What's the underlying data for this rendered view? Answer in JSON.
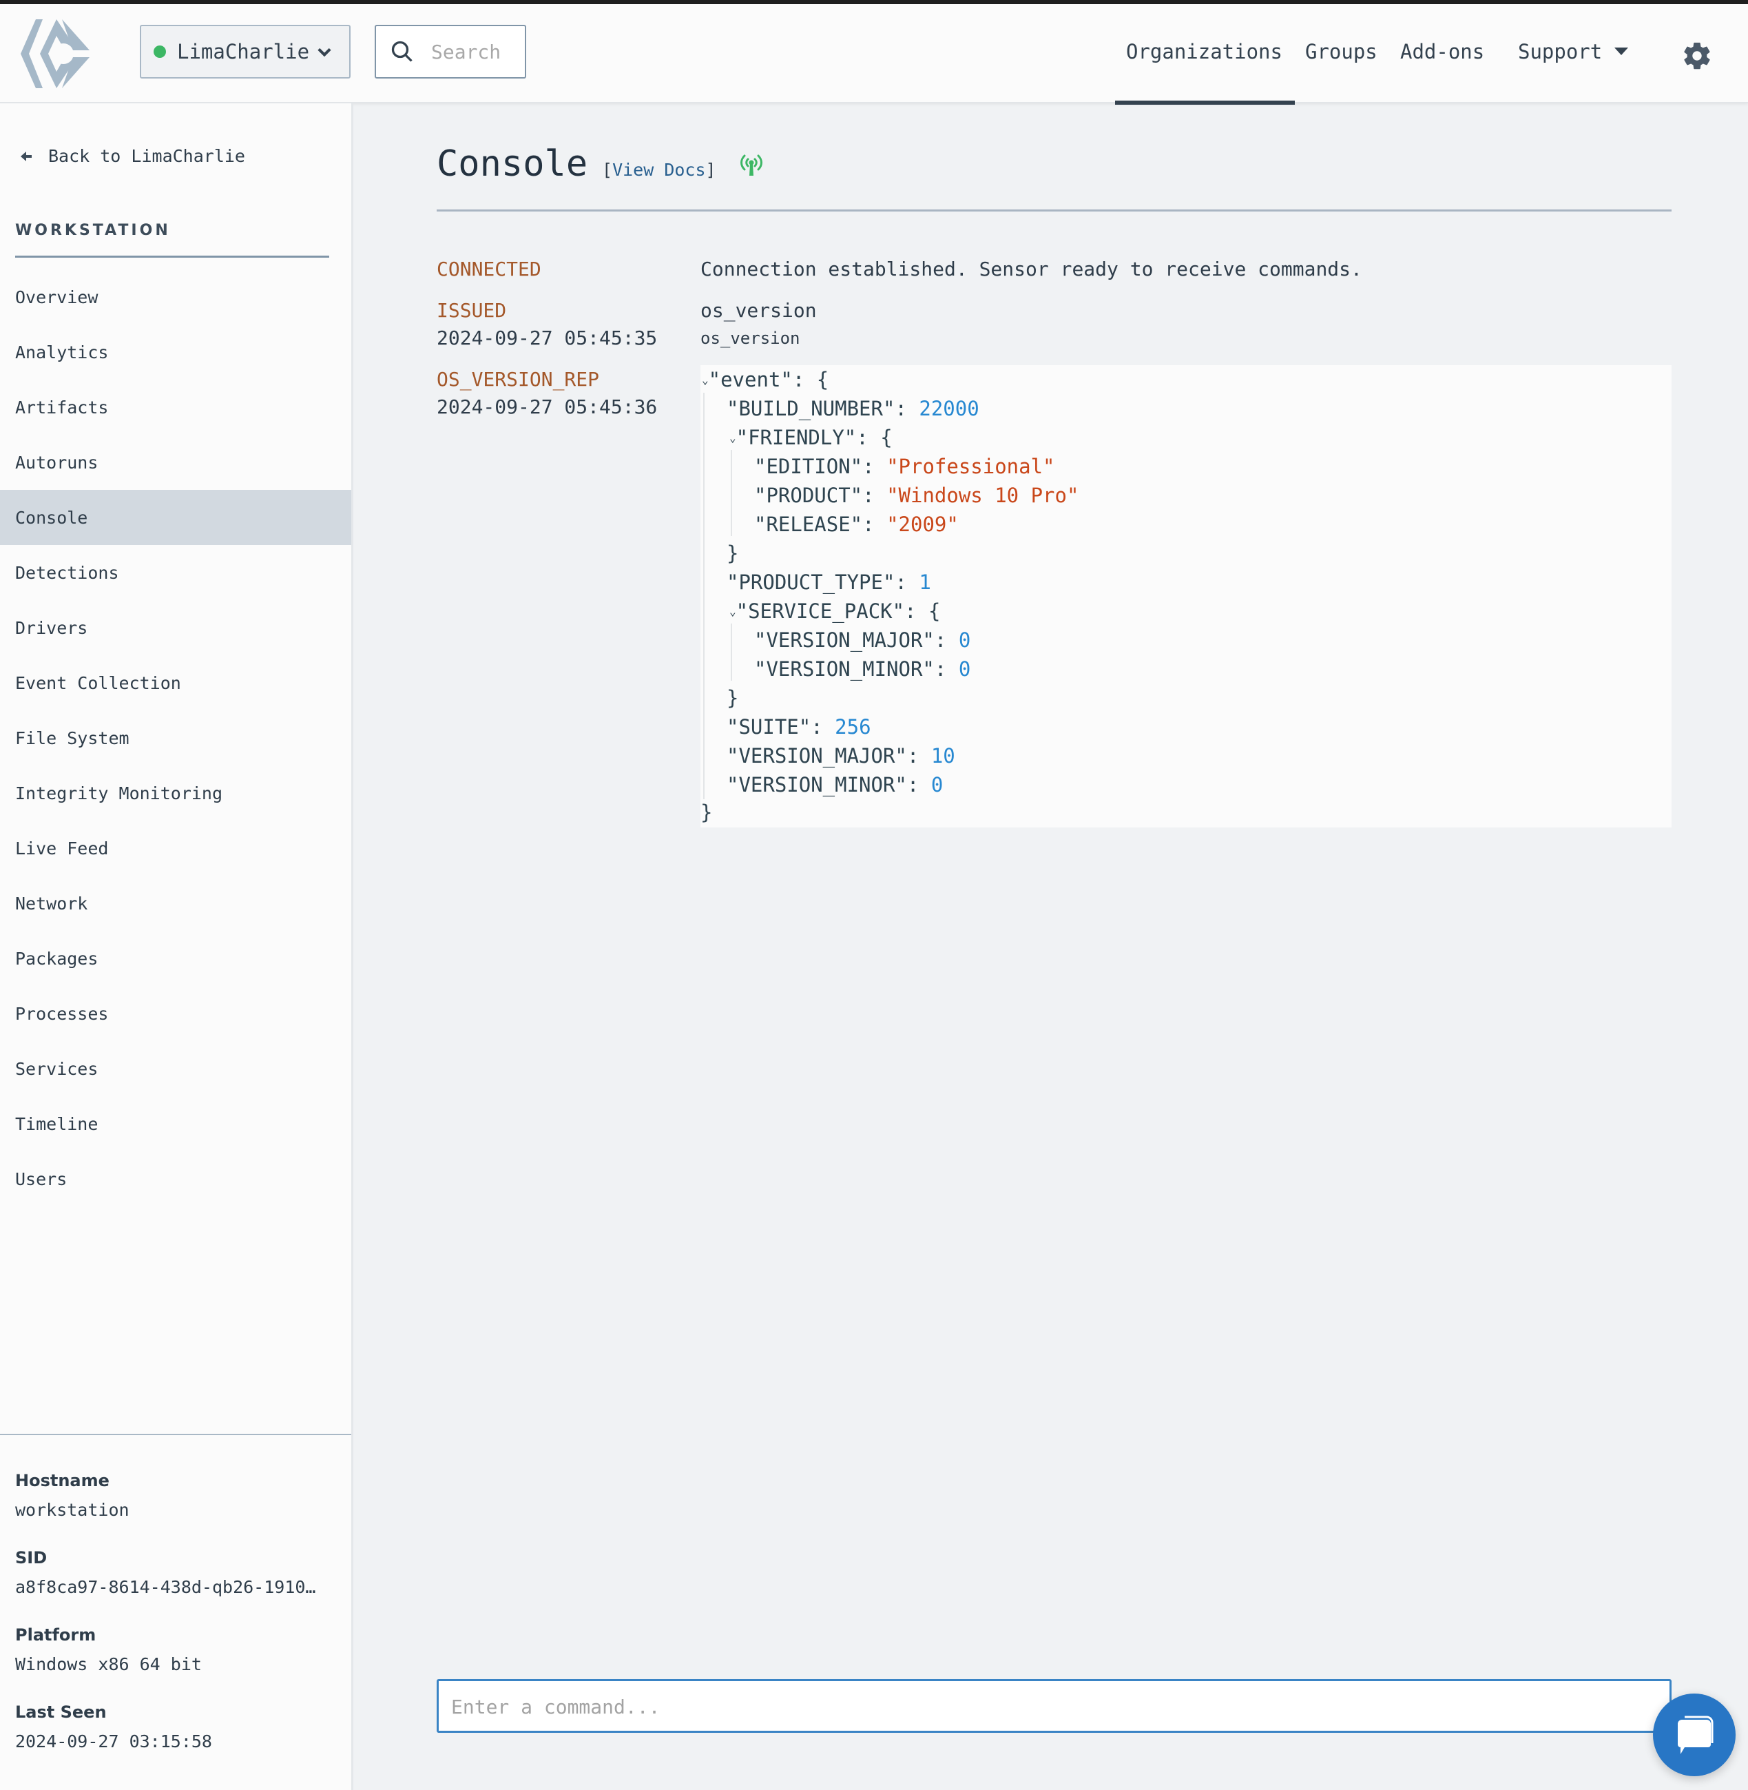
{
  "header": {
    "org_name": "LimaCharlie",
    "org_status_color": "#3cb764",
    "search_placeholder": "Search",
    "nav": [
      "Organizations",
      "Groups",
      "Add-ons",
      "Support"
    ],
    "active_nav": "Organizations"
  },
  "sidebar": {
    "back_label": "Back to LimaCharlie",
    "section_title": "WORKSTATION",
    "items": [
      {
        "label": "Overview"
      },
      {
        "label": "Analytics"
      },
      {
        "label": "Artifacts"
      },
      {
        "label": "Autoruns"
      },
      {
        "label": "Console",
        "active": true
      },
      {
        "label": "Detections"
      },
      {
        "label": "Drivers"
      },
      {
        "label": "Event Collection"
      },
      {
        "label": "File System"
      },
      {
        "label": "Integrity Monitoring"
      },
      {
        "label": "Live Feed"
      },
      {
        "label": "Network"
      },
      {
        "label": "Packages"
      },
      {
        "label": "Processes"
      },
      {
        "label": "Services"
      },
      {
        "label": "Timeline"
      },
      {
        "label": "Users"
      }
    ],
    "info": {
      "hostname_label": "Hostname",
      "hostname": "workstation",
      "sid_label": "SID",
      "sid": "a8f8ca97-8614-438d-qb26-1910…",
      "platform_label": "Platform",
      "platform": "Windows x86 64 bit",
      "last_seen_label": "Last Seen",
      "last_seen": "2024-09-27 03:15:58"
    }
  },
  "main": {
    "title": "Console",
    "docs_open": "[",
    "docs_label": "View Docs",
    "docs_close": "]",
    "connection_icon_color": "#3cb764",
    "log": {
      "connected": {
        "label": "CONNECTED",
        "message": "Connection established. Sensor ready to receive commands."
      },
      "issued": {
        "label": "ISSUED",
        "timestamp": "2024-09-27 05:45:35",
        "command": "os_version",
        "sub": "os_version"
      },
      "response": {
        "label": "OS_VERSION_REP",
        "timestamp": "2024-09-27 05:45:36"
      }
    },
    "json_lines": {
      "event_key": "\"event\"",
      "build_key": "\"BUILD_NUMBER\"",
      "build_val": "22000",
      "friendly_key": "\"FRIENDLY\"",
      "edition_key": "\"EDITION\"",
      "edition_val": "\"Professional\"",
      "product_key": "\"PRODUCT\"",
      "product_val": "\"Windows 10 Pro\"",
      "release_key": "\"RELEASE\"",
      "release_val": "\"2009\"",
      "product_type_key": "\"PRODUCT_TYPE\"",
      "product_type_val": "1",
      "service_pack_key": "\"SERVICE_PACK\"",
      "sp_major_key": "\"VERSION_MAJOR\"",
      "sp_major_val": "0",
      "sp_minor_key": "\"VERSION_MINOR\"",
      "sp_minor_val": "0",
      "suite_key": "\"SUITE\"",
      "suite_val": "256",
      "major_key": "\"VERSION_MAJOR\"",
      "major_val": "10",
      "minor_key": "\"VERSION_MINOR\"",
      "minor_val": "0",
      "colon": ":",
      "open_brace": "{",
      "close_brace": "}",
      "toggle": "⌄"
    },
    "command_placeholder": "Enter a command..."
  }
}
